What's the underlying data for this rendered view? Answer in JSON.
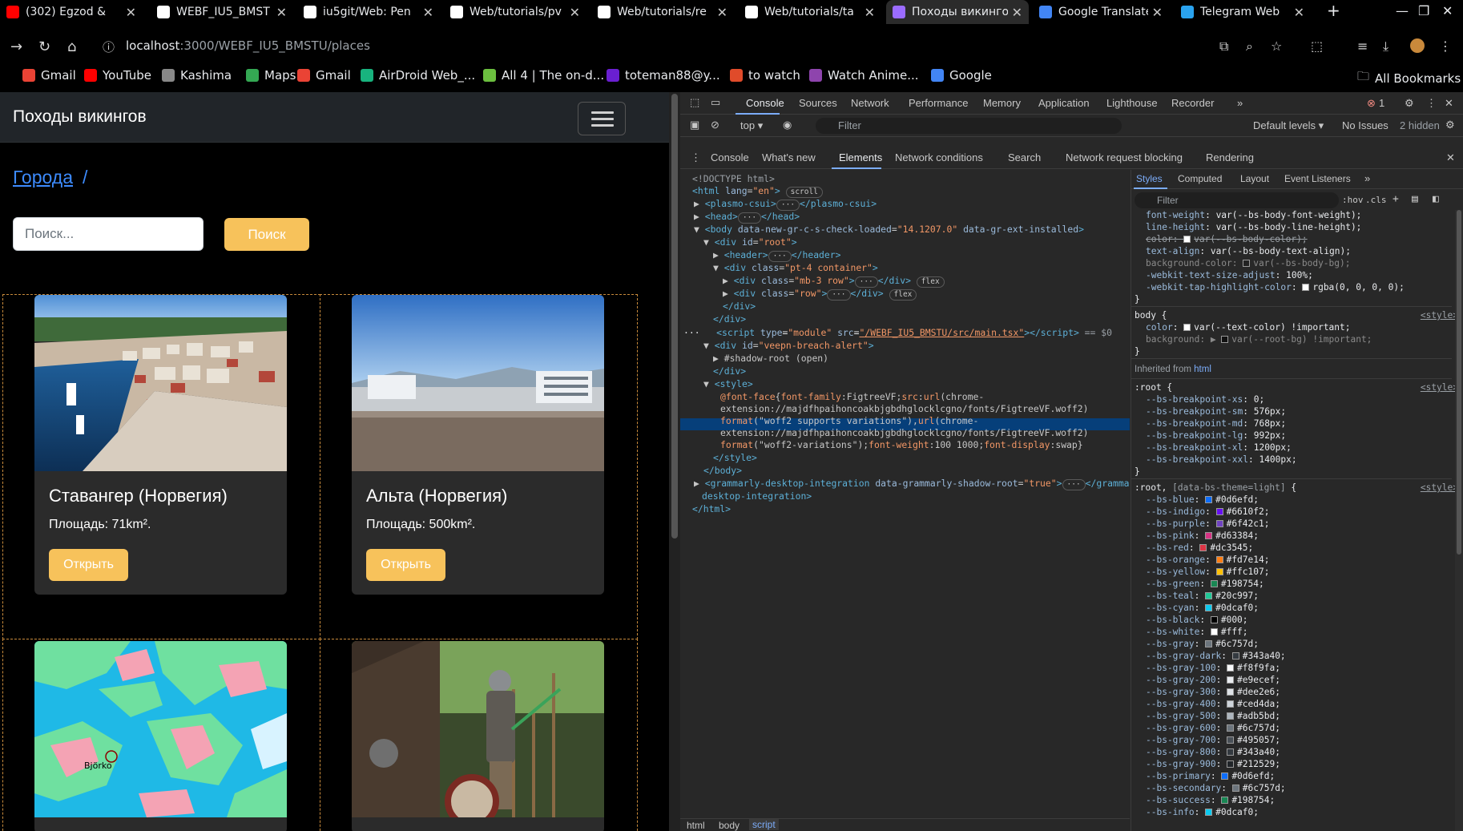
{
  "tabs": [
    {
      "title": "(302) Egzod & ",
      "icon_color": "#ff0000",
      "icon": "youtube-icon"
    },
    {
      "title": "WEBF_IU5_BMST",
      "icon_color": "#ffffff",
      "icon": "github-icon"
    },
    {
      "title": "iu5git/Web: Pen",
      "icon_color": "#ffffff",
      "icon": "github-icon"
    },
    {
      "title": "Web/tutorials/pv",
      "icon_color": "#ffffff",
      "icon": "github-icon"
    },
    {
      "title": "Web/tutorials/re",
      "icon_color": "#ffffff",
      "icon": "github-icon"
    },
    {
      "title": "Web/tutorials/ta",
      "icon_color": "#ffffff",
      "icon": "github-icon"
    },
    {
      "title": "Походы викинго",
      "icon_color": "#9b6cff",
      "icon": "vite-icon",
      "active": true
    },
    {
      "title": "Google Translate",
      "icon_color": "#4285f4",
      "icon": "google-translate-icon"
    },
    {
      "title": "Telegram Web",
      "icon_color": "#2aa3ef",
      "icon": "telegram-icon"
    }
  ],
  "address": {
    "host": "localhost",
    "path": ":3000/WEBF_IU5_BMSTU/places"
  },
  "bookmarks": [
    {
      "label": "Gmail",
      "color": "#ea4335"
    },
    {
      "label": "YouTube",
      "color": "#ff0000"
    },
    {
      "label": "Kashima",
      "color": "#888888"
    },
    {
      "label": "Maps",
      "color": "#34a853"
    },
    {
      "label": "Gmail",
      "color": "#ea4335"
    },
    {
      "label": "AirDroid Web_...",
      "color": "#18b37e"
    },
    {
      "label": "All 4 | The on-d...",
      "color": "#6bbf3f"
    },
    {
      "label": "toteman88@y...",
      "color": "#6a1fd1"
    },
    {
      "label": "to watch",
      "color": "#e04b2a"
    },
    {
      "label": "Watch Anime...",
      "color": "#8e44ad"
    },
    {
      "label": "Google",
      "color": "#4285f4"
    }
  ],
  "all_bookmarks": "All Bookmarks",
  "page": {
    "brand": "Походы викингов",
    "breadcrumb_link": "Города",
    "breadcrumb_sep": "/",
    "search_placeholder": "Поиск...",
    "search_button": "Поиск",
    "cards": [
      {
        "title": "Ставангер (Норвегия)",
        "area": "Площадь: 71km².",
        "button": "Открыть"
      },
      {
        "title": "Альта (Норвегия)",
        "area": "Площадь: 500km².",
        "button": "Открыть"
      },
      {
        "map_label": "Björko"
      },
      {}
    ]
  },
  "devtools": {
    "top_tabs": [
      "Console",
      "Sources",
      "Network",
      "Performance",
      "Memory",
      "Application",
      "Lighthouse",
      "Recorder"
    ],
    "error_count": "1",
    "console_context": "top",
    "console_filter": "Filter",
    "levels": "Default levels",
    "issues": "No Issues",
    "hidden": "2 hidden",
    "drawer_tabs": [
      "Console",
      "What's new",
      "Elements",
      "Network conditions",
      "Search",
      "Network request blocking",
      "Rendering"
    ],
    "styles_tabs": [
      "Styles",
      "Computed",
      "Layout",
      "Event Listeners"
    ],
    "styles_filter": "Filter",
    "hov": ":hov",
    "cls": ".cls",
    "footer_path": [
      "html",
      "body",
      "script"
    ]
  }
}
